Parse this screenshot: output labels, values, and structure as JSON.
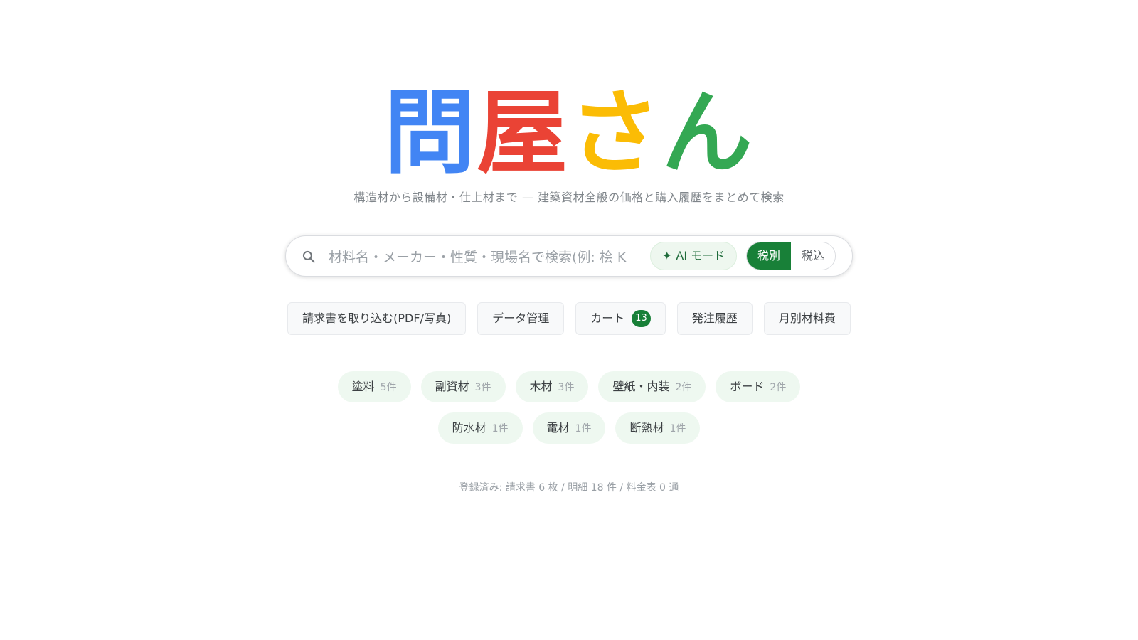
{
  "logo": {
    "chars": [
      {
        "text": "問",
        "color": "#4285F4"
      },
      {
        "text": "屋",
        "color": "#EA4335"
      },
      {
        "text": "さ",
        "color": "#FBBC05"
      },
      {
        "text": "ん",
        "color": "#34A853"
      }
    ]
  },
  "tagline": "構造材から設備材・仕上材まで — 建築資材全般の価格と購入履歴をまとめて検索",
  "search": {
    "placeholder": "材料名・メーカー・性質・現場名で検索(例: 桧 K",
    "value": "",
    "ai_mode_label": "AI モード",
    "ai_icon": "sparkle-icon",
    "tax_options": [
      {
        "label": "税別",
        "active": true
      },
      {
        "label": "税込",
        "active": false
      }
    ]
  },
  "actions": [
    {
      "label": "請求書を取り込む(PDF/写真)"
    },
    {
      "label": "データ管理"
    },
    {
      "label": "カート",
      "badge": "13"
    },
    {
      "label": "発注履歴"
    },
    {
      "label": "月別材料費"
    }
  ],
  "categories": {
    "row1": [
      {
        "name": "塗料",
        "count": "5件"
      },
      {
        "name": "副資材",
        "count": "3件"
      },
      {
        "name": "木材",
        "count": "3件"
      },
      {
        "name": "壁紙・内装",
        "count": "2件"
      },
      {
        "name": "ボード",
        "count": "2件"
      }
    ],
    "row2": [
      {
        "name": "防水材",
        "count": "1件"
      },
      {
        "name": "電材",
        "count": "1件"
      },
      {
        "name": "断熱材",
        "count": "1件"
      }
    ]
  },
  "stats": "登録済み: 請求書 6 枚 / 明細 18 件 / 料金表 0 通",
  "colors": {
    "accent": "#188038",
    "chip_bg": "#eef8f0"
  }
}
